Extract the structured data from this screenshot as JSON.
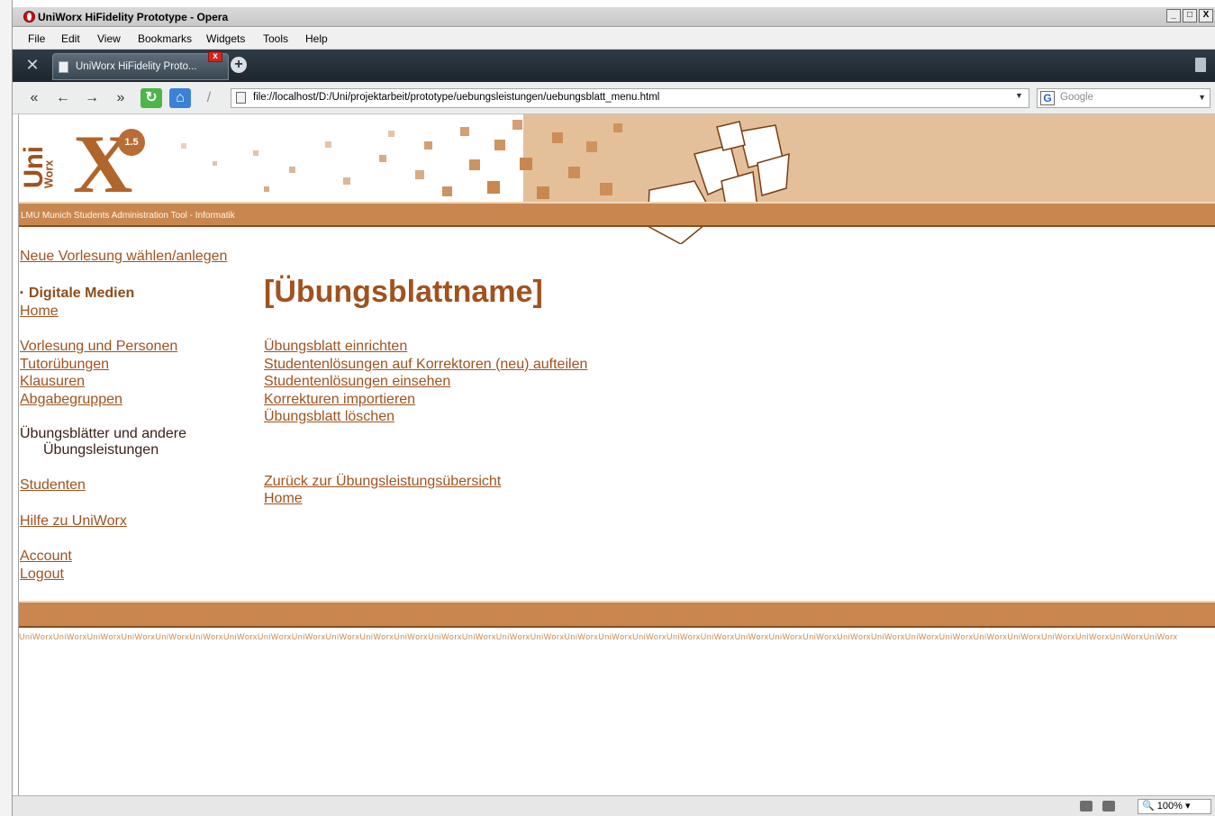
{
  "window": {
    "title": "UniWorx HiFidelity Prototype - Opera",
    "buttons": {
      "minimize": "_",
      "maximize": "□",
      "close": "X"
    }
  },
  "menu": [
    "File",
    "Edit",
    "View",
    "Bookmarks",
    "Widgets",
    "Tools",
    "Help"
  ],
  "tabs": [
    {
      "label": "UniWorx HiFidelity Proto..."
    }
  ],
  "address": {
    "url": "file://localhost/D:/Uni/projektarbeit/prototype/uebungsleistungen/uebungsblatt_menu.html"
  },
  "search": {
    "placeholder": "Google",
    "engine_icon": "G"
  },
  "banner": {
    "logo_uni": "Uni",
    "logo_worx": "Worx",
    "logo_x": "X",
    "version": "1.5",
    "subtitle": "LMU Munich Students Administration Tool - Informatik"
  },
  "nav": {
    "new_lecture": "Neue Vorlesung wählen/anlegen",
    "course": "Digitale Medien",
    "home": "Home",
    "lecture_persons": "Vorlesung und Personen",
    "tutorials": "Tutorübungen",
    "exams": "Klausuren",
    "groups": "Abgabegruppen",
    "current_line1": "Übungsblätter und andere",
    "current_line2": "Übungsleistungen",
    "students": "Studenten",
    "help": "Hilfe zu UniWorx",
    "account": "Account",
    "logout": "Logout"
  },
  "main": {
    "title": "[Übungsblattname]",
    "actions": [
      "Übungsblatt einrichten",
      "Studentenlösungen auf Korrektoren (neu) aufteilen",
      "Studentenlösungen einsehen",
      "Korrekturen importieren",
      "Übungsblatt löschen"
    ],
    "back": "Zurück zur Übungsleistungsübersicht",
    "home": "Home"
  },
  "footer": {
    "pattern": "UniWorxUniWorxUniWorxUniWorxUniWorxUniWorxUniWorxUniWorxUniWorxUniWorxUniWorxUniWorxUniWorxUniWorxUniWorxUniWorxUniWorxUniWorxUniWorxUniWorxUniWorxUniWorxUniWorxUniWorxUniWorxUniWorxUniWorxUniWorxUniWorxUniWorxUniWorxUniWorxUniWorxUniWorx"
  },
  "status": {
    "zoom": "100%"
  },
  "colors": {
    "accent": "#a0521f",
    "band": "#c9874f",
    "banner_tan": "#e4c09a"
  }
}
